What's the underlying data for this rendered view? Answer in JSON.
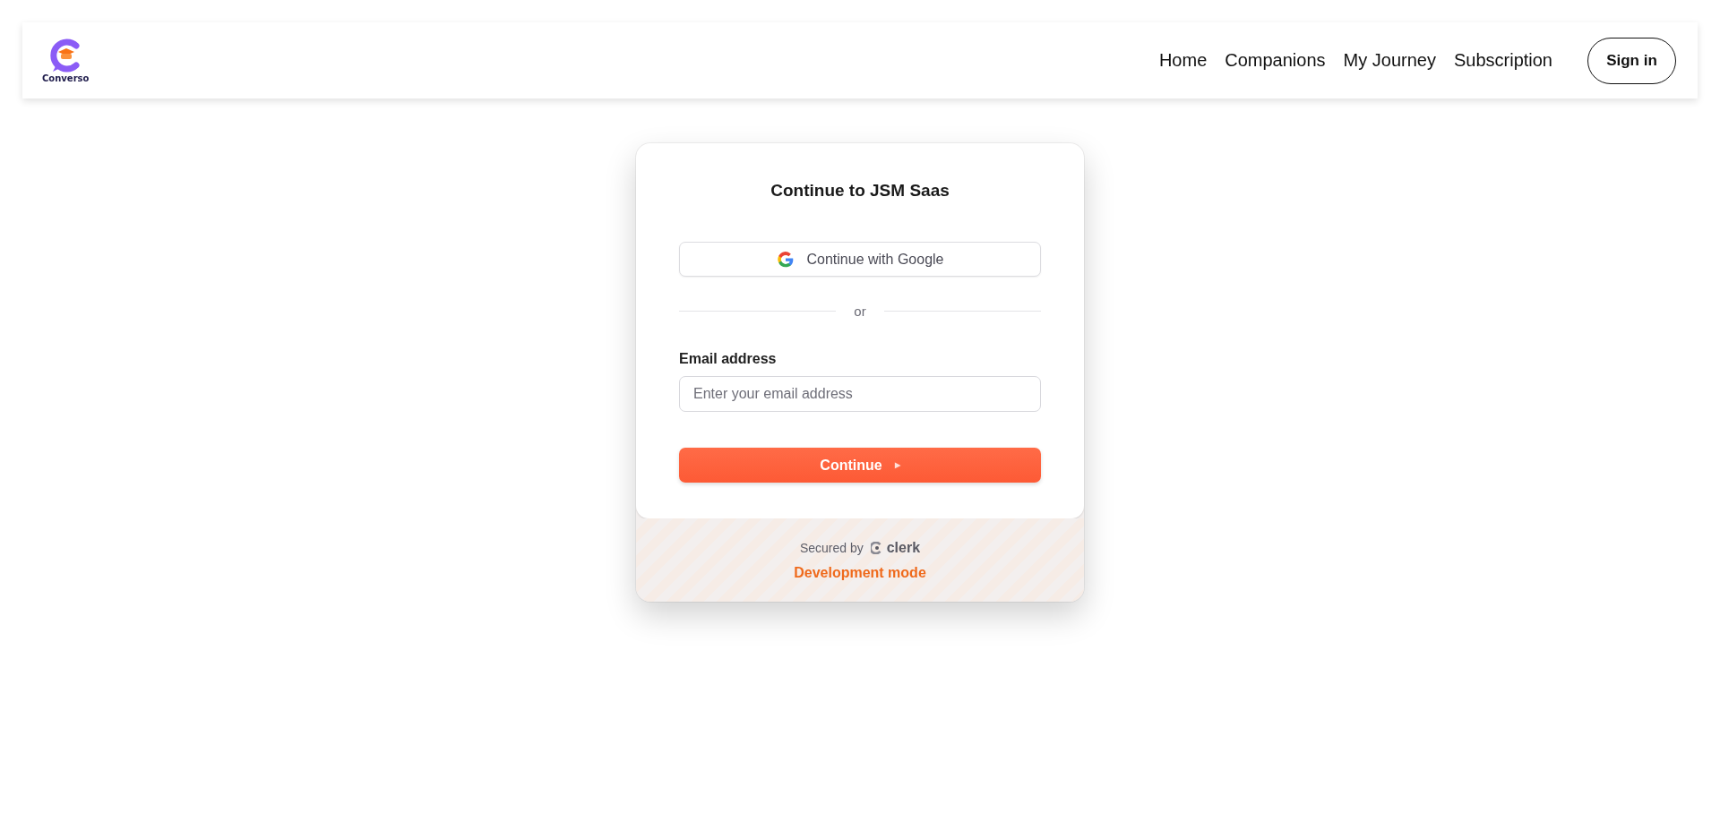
{
  "navbar": {
    "logo_text": "Converso",
    "links": [
      {
        "label": "Home"
      },
      {
        "label": "Companions"
      },
      {
        "label": "My Journey"
      },
      {
        "label": "Subscription"
      }
    ],
    "sign_in": "Sign in"
  },
  "card": {
    "title": "Continue to JSM Saas",
    "google_button": "Continue with Google",
    "divider": "or",
    "email_label": "Email address",
    "email_placeholder": "Enter your email address",
    "continue_button": "Continue",
    "continue_icon": "▶",
    "secured_by": "Secured by",
    "clerk_logo": "clerk",
    "dev_mode": "Development mode"
  }
}
